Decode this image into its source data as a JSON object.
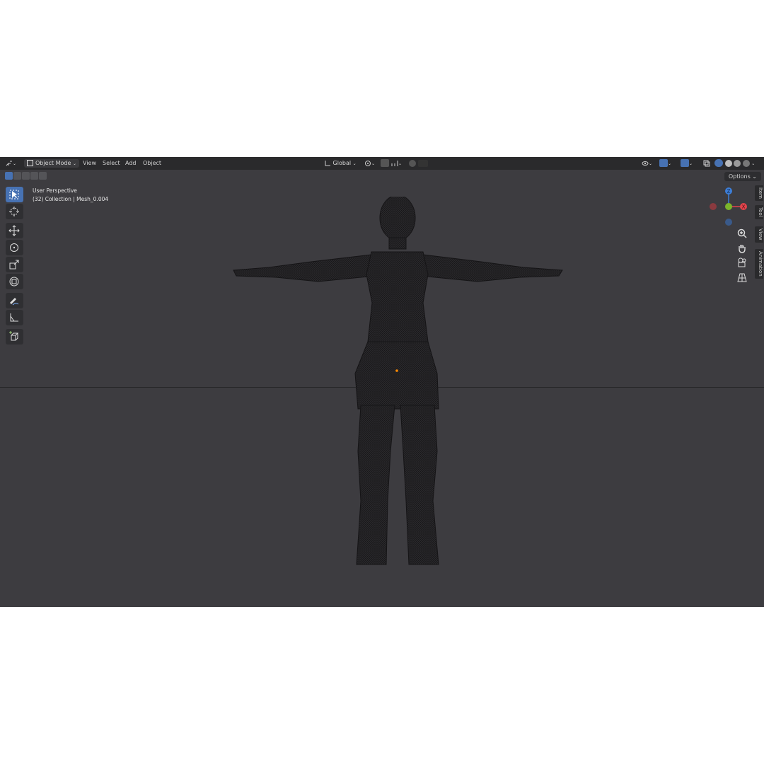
{
  "header": {
    "mode_label": "Object Mode",
    "menu": [
      "View",
      "Select",
      "Add",
      "Object"
    ],
    "transform_orientation": "Global"
  },
  "options_label": "Options",
  "viewport": {
    "view_name": "User Perspective",
    "collection_info": "(32) Collection | Mesh_0.004"
  },
  "right_tabs": [
    "Item",
    "Tool",
    "View",
    "Animation"
  ],
  "gizmo": {
    "z_label": "Z",
    "x_label": "X"
  },
  "colors": {
    "accent": "#4772b3",
    "x_axis": "#e2444c",
    "y_axis": "#7cb52b",
    "z_axis": "#3d7ed8",
    "origin": "#ff8a00"
  }
}
